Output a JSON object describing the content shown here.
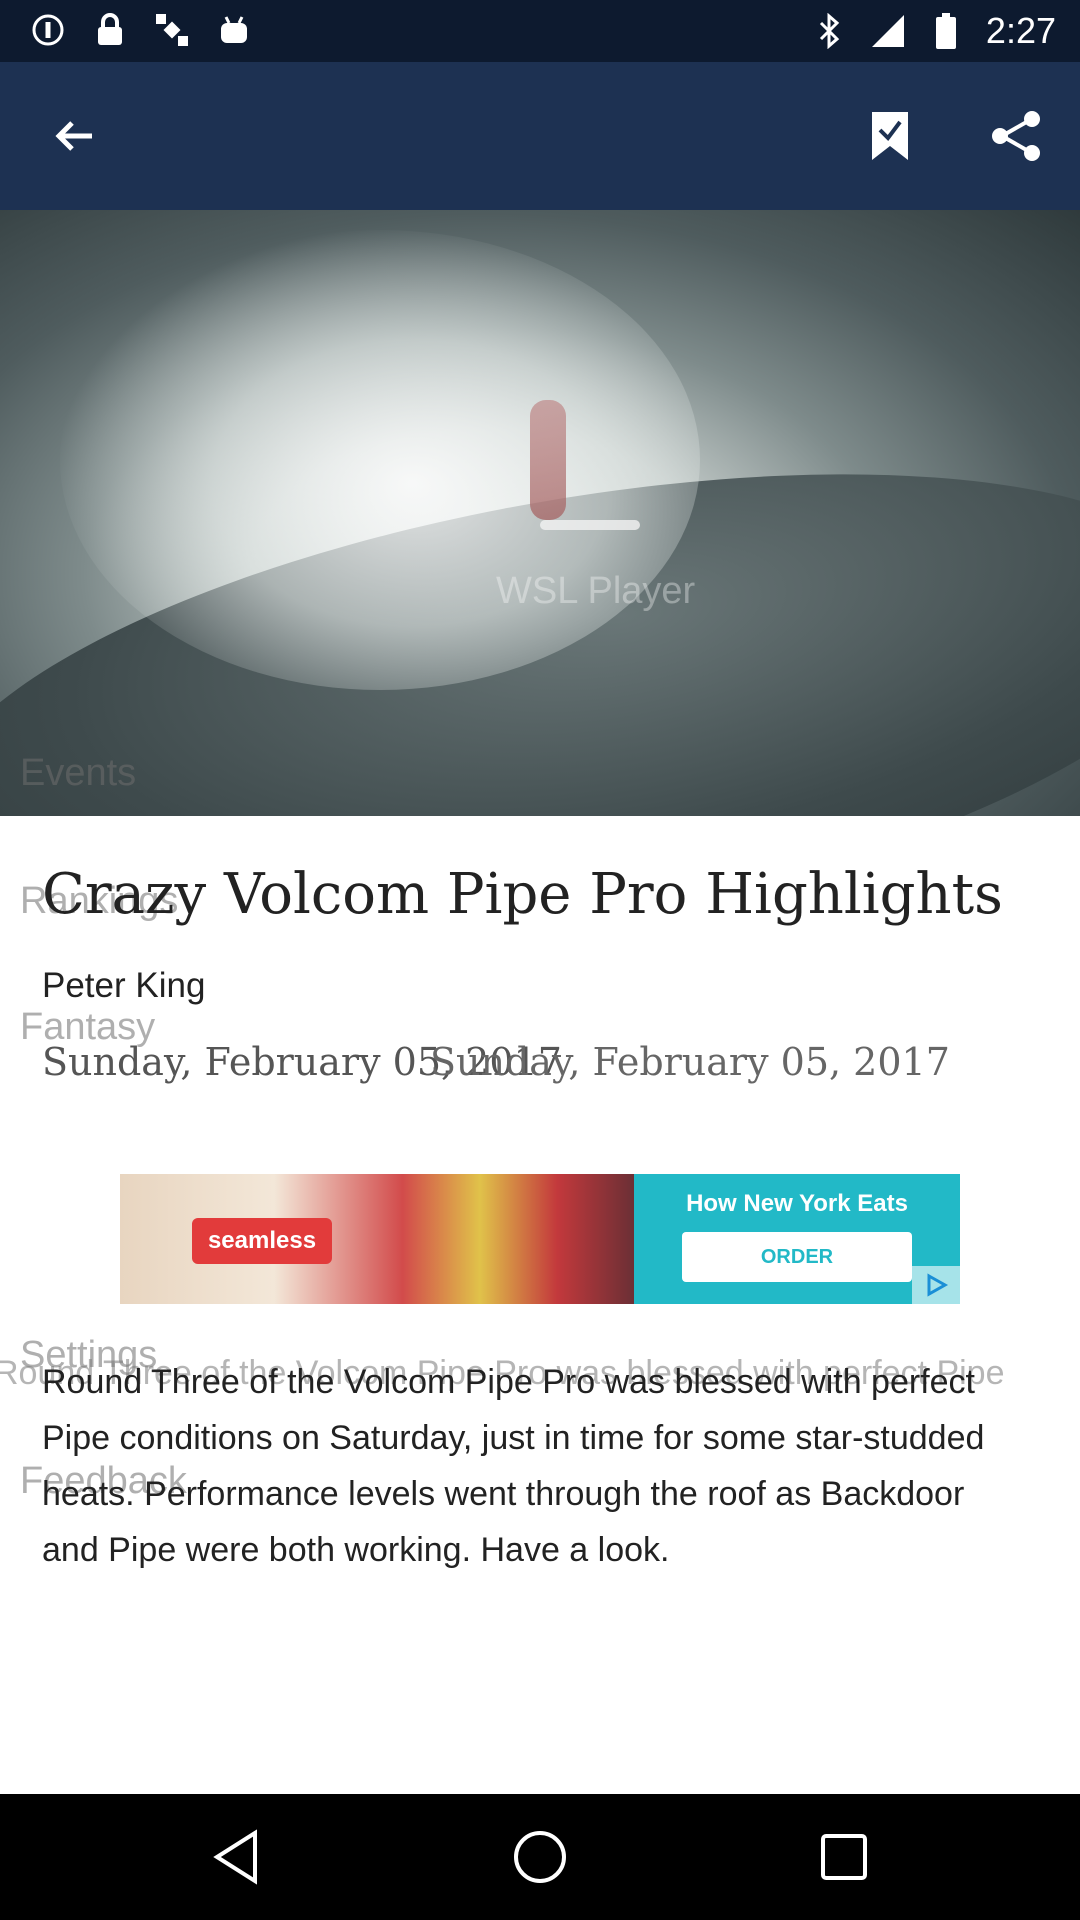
{
  "status_bar": {
    "time": "2:27",
    "left_icons": [
      "info-icon",
      "lock-icon",
      "satellite-fake-gps-icon",
      "android-icon"
    ],
    "right_icons": [
      "bluetooth-icon",
      "signal-icon",
      "battery-icon"
    ]
  },
  "toolbar": {
    "icons": [
      "back-arrow-icon",
      "bookmark-check-icon",
      "share-icon"
    ]
  },
  "hero": {
    "watermark": "WSL Player"
  },
  "drawer_ghost": {
    "items": [
      "Events",
      "Rankings",
      "Fantasy",
      "Settings",
      "Feedback"
    ]
  },
  "article": {
    "title": "Crazy Volcom Pipe Pro Highlights",
    "author": "Peter King",
    "date": "Sunday, February 05, 2017",
    "date_overlay": "Sunday, February 05, 2017",
    "body": "Round Three of the Volcom Pipe Pro was blessed with perfect Pipe conditions on Saturday, just in time for some star-studded heats. Performance levels went through the roof as Backdoor and Pipe were both working. Have a look.",
    "body_overlay": "Round Three of the Volcom Pipe Pro was blessed with perfect Pipe"
  },
  "ad": {
    "brand": "seamless",
    "headline": "How New York Eats",
    "cta": "ORDER"
  },
  "nav_bar": {
    "icons": [
      "back-triangle-icon",
      "home-circle-icon",
      "recents-square-icon"
    ]
  }
}
